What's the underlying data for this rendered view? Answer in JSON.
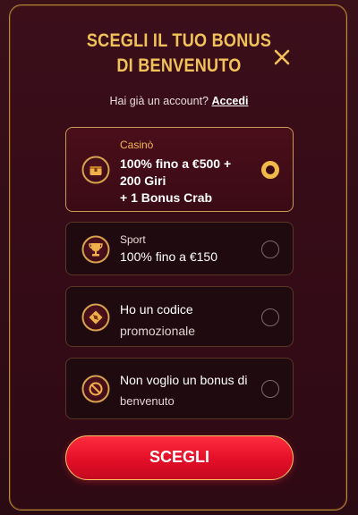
{
  "modal": {
    "title_line1": "SCEGLI IL TUO BONUS",
    "title_line2": "DI BENVENUTO",
    "login_prompt": "Hai già un account?",
    "login_link": "Accedi",
    "cta_label": "SCEGLI"
  },
  "options": [
    {
      "category": "Casinò",
      "lines": [
        "100% fino a €500 +",
        "200 Giri",
        "+ 1 Bonus Crab"
      ],
      "selected": true,
      "icon": "treasure-chest-icon"
    },
    {
      "category": "Sport",
      "lines": [
        "100% fino a €150"
      ],
      "selected": false,
      "icon": "trophy-icon"
    },
    {
      "category": "",
      "lines": [
        "Ho un codice",
        "promozionale"
      ],
      "selected": false,
      "icon": "promo-code-icon"
    },
    {
      "category": "",
      "lines": [
        "Non voglio un bonus di",
        "benvenuto"
      ],
      "selected": false,
      "icon": "no-bonus-icon"
    }
  ],
  "colors": {
    "gold": "#f2c25a",
    "cta_red": "#e30e27",
    "modal_bg": "#330b16"
  }
}
